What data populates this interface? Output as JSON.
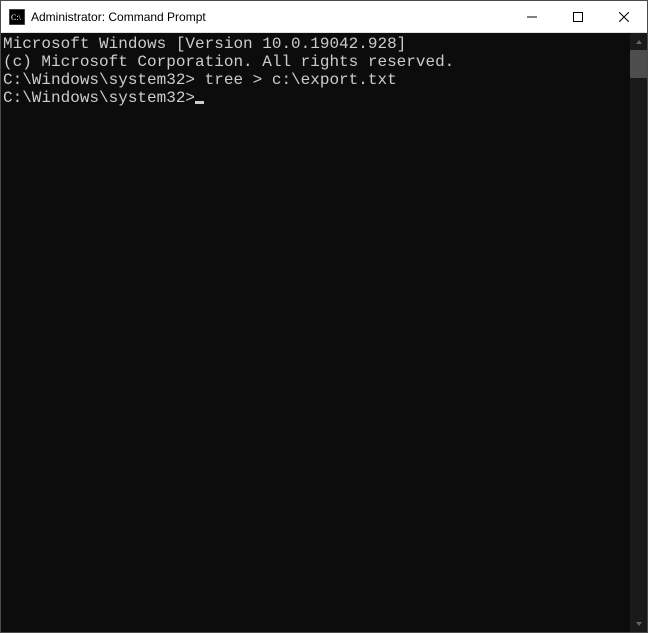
{
  "window": {
    "title": "Administrator: Command Prompt"
  },
  "terminal": {
    "line1": "Microsoft Windows [Version 10.0.19042.928]",
    "line2": "(c) Microsoft Corporation. All rights reserved.",
    "blank1": "",
    "prompt1_path": "C:\\Windows\\system32>",
    "prompt1_cmd": " tree > c:\\export.txt",
    "blank2": "",
    "prompt2_path": "C:\\Windows\\system32>"
  }
}
